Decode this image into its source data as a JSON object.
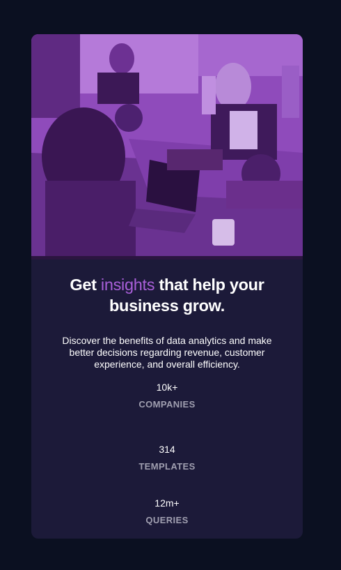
{
  "card": {
    "heading": {
      "before": "Get ",
      "accent": "insights",
      "after": " that help your business grow."
    },
    "description": "Discover the benefits of data analytics and make better decisions regarding revenue, customer experience, and overall efficiency.",
    "stats": [
      {
        "value": "10k+",
        "label": "COMPANIES"
      },
      {
        "value": "314",
        "label": "TEMPLATES"
      },
      {
        "value": "12m+",
        "label": "QUERIES"
      }
    ]
  },
  "colors": {
    "page_background": "#0b1021",
    "card_background": "#1c1a39",
    "accent": "#a95fd9",
    "stat_label": "#a09fb0",
    "image_tint": "#7a3da0"
  }
}
